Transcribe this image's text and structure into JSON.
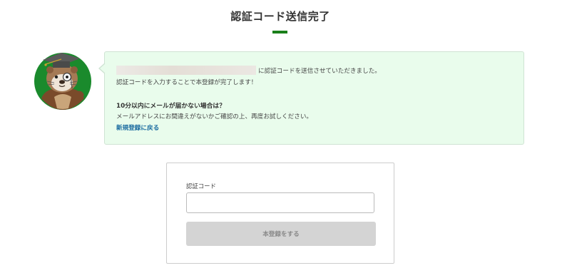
{
  "page": {
    "title": "認証コード送信完了"
  },
  "colors": {
    "accent": "#1a7f1a",
    "message_bg": "#e9fcec",
    "link": "#1a6ba0",
    "button_disabled_bg": "#d4d4d4"
  },
  "message": {
    "email_masked": "",
    "sent_suffix": "に認証コードを送信させていただきました。",
    "instruction": "認証コードを入力することで本登録が完了します！",
    "not_received_heading": "10分以内にメールが届かない場合は？",
    "check_note": "メールアドレスにお間違えがないかご確認の上、再度お試しください。",
    "back_link": "新規登録に戻る"
  },
  "mascot": {
    "icon": "sea-otter-professor-avatar"
  },
  "form": {
    "code_label": "認証コード",
    "code_value": "",
    "submit_label": "本登録をする",
    "submit_disabled": true
  }
}
